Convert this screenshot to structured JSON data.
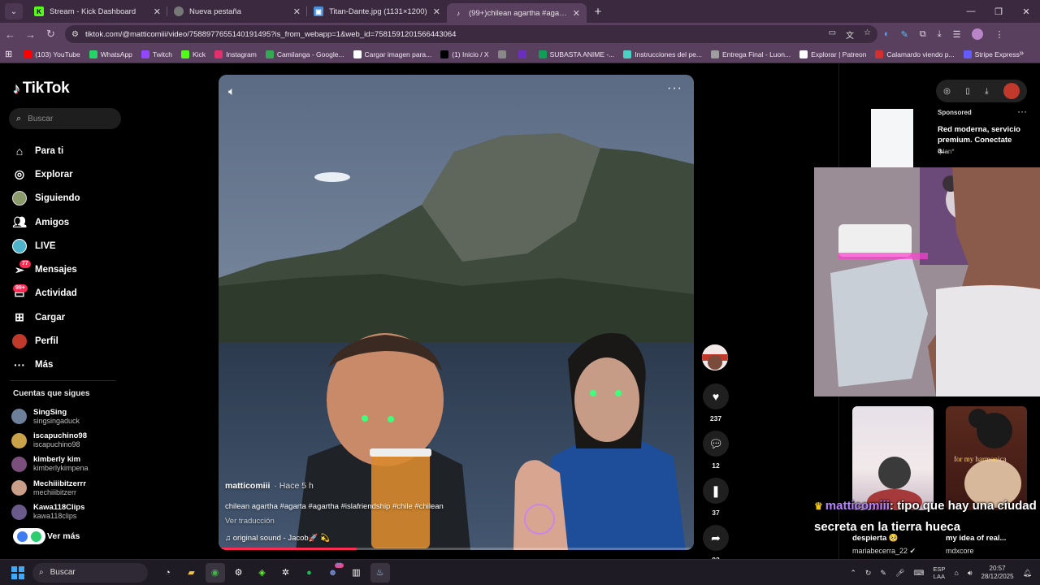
{
  "tabs": [
    {
      "title": "Stream - Kick Dashboard",
      "icon": "kick-icon",
      "color": "#53fc18",
      "active": false
    },
    {
      "title": "Nueva pestaña",
      "icon": "chrome-icon",
      "color": "#cccccc",
      "active": false
    },
    {
      "title": "Titan-Dante.jpg (1131×1200)",
      "icon": "image-icon",
      "color": "#4a90d9",
      "active": false
    },
    {
      "title": "(99+)chilean agartha #agarta #",
      "icon": "tiktok-icon",
      "color": "#000000",
      "active": true
    }
  ],
  "address": {
    "url": "tiktok.com/@matticomiii/video/7588977655140191495?is_from_webapp=1&web_id=7581591201566443064"
  },
  "bookmarks": [
    {
      "label": "(103) YouTube",
      "color": "#ff0000"
    },
    {
      "label": "WhatsApp",
      "color": "#25d366"
    },
    {
      "label": "Twitch",
      "color": "#9146ff"
    },
    {
      "label": "Kick",
      "color": "#53fc18"
    },
    {
      "label": "Instagram",
      "color": "#e1306c"
    },
    {
      "label": "Camilanga - Google...",
      "color": "#34a853"
    },
    {
      "label": "Cargar imagen para...",
      "color": "#ffffff"
    },
    {
      "label": "(1) Inicio / X",
      "color": "#000000"
    },
    {
      "label": "",
      "color": "#888888"
    },
    {
      "label": "",
      "color": "#6b2fbf"
    },
    {
      "label": "SUBASTA ANIME -...",
      "color": "#0f9d58"
    },
    {
      "label": "Instrucciones del pe...",
      "color": "#4dd0c4"
    },
    {
      "label": "Entrega Final - Luon...",
      "color": "#9e9e9e"
    },
    {
      "label": "Explorar | Patreon",
      "color": "#ffffff"
    },
    {
      "label": "Calamardo viendo p...",
      "color": "#d32f2f"
    },
    {
      "label": "Stripe Express",
      "color": "#635bff"
    }
  ],
  "tiktok": {
    "brand": "TikTok",
    "search_placeholder": "Buscar",
    "nav": [
      {
        "label": "Para ti",
        "icon": "home-icon"
      },
      {
        "label": "Explorar",
        "icon": "compass-icon"
      },
      {
        "label": "Siguiendo",
        "icon": "following-avatar-icon"
      },
      {
        "label": "Amigos",
        "icon": "friends-icon"
      },
      {
        "label": "LIVE",
        "icon": "live-icon"
      },
      {
        "label": "Mensajes",
        "icon": "messages-icon",
        "badge": "77"
      },
      {
        "label": "Actividad",
        "icon": "activity-icon",
        "badge": "99+"
      },
      {
        "label": "Cargar",
        "icon": "upload-icon"
      },
      {
        "label": "Perfil",
        "icon": "profile-avatar-icon"
      },
      {
        "label": "Más",
        "icon": "more-icon"
      }
    ],
    "following_heading": "Cuentas que sigues",
    "following": [
      {
        "name": "SingSing",
        "handle": "singsingaduck",
        "color": "#6e7f9a"
      },
      {
        "name": "iscapuchino98",
        "handle": "iscapuchino98",
        "color": "#caa24a"
      },
      {
        "name": "kimberly kim",
        "handle": "kimberlykimpena",
        "color": "#7a4f7c"
      },
      {
        "name": "Mechiiibitzerrr",
        "handle": "mechiiibitzerr",
        "color": "#c99f8a"
      },
      {
        "name": "Kawa118Clips",
        "handle": "kawa118clips",
        "color": "#6a5a8c"
      }
    ],
    "see_more": "Ver más"
  },
  "video": {
    "author": "matticomiii",
    "time_ago": "· Hace 5 h",
    "caption": "chilean agartha #agarta #agartha #islafriendship #chile #chilean",
    "translate": "Ver traducción",
    "sound": "original sound - Jacob🚀 💫",
    "progress": 0.29
  },
  "actions": {
    "likes": "237",
    "comments": "12",
    "saves": "37",
    "shares": "93"
  },
  "sponsored": {
    "label": "Sponsored",
    "headline": "Red moderna, servicio premium. Conectate a...",
    "source": "Iplan*"
  },
  "cards": [
    {
      "title": "despierta 🥺",
      "author": "mariabecerra_22 ✔"
    },
    {
      "title": "my idea of real...",
      "author": "mdxcore",
      "overlay": "for my harmonica"
    }
  ],
  "chat": {
    "user": "matticomiii",
    "message": ": tipo que hay una ciudad secreta en la tierra hueca"
  },
  "taskbar": {
    "search": "Buscar",
    "lang": "ESP",
    "lang2": "LAA",
    "time": "20:57",
    "date": "28/12/2025",
    "badge": "99"
  }
}
